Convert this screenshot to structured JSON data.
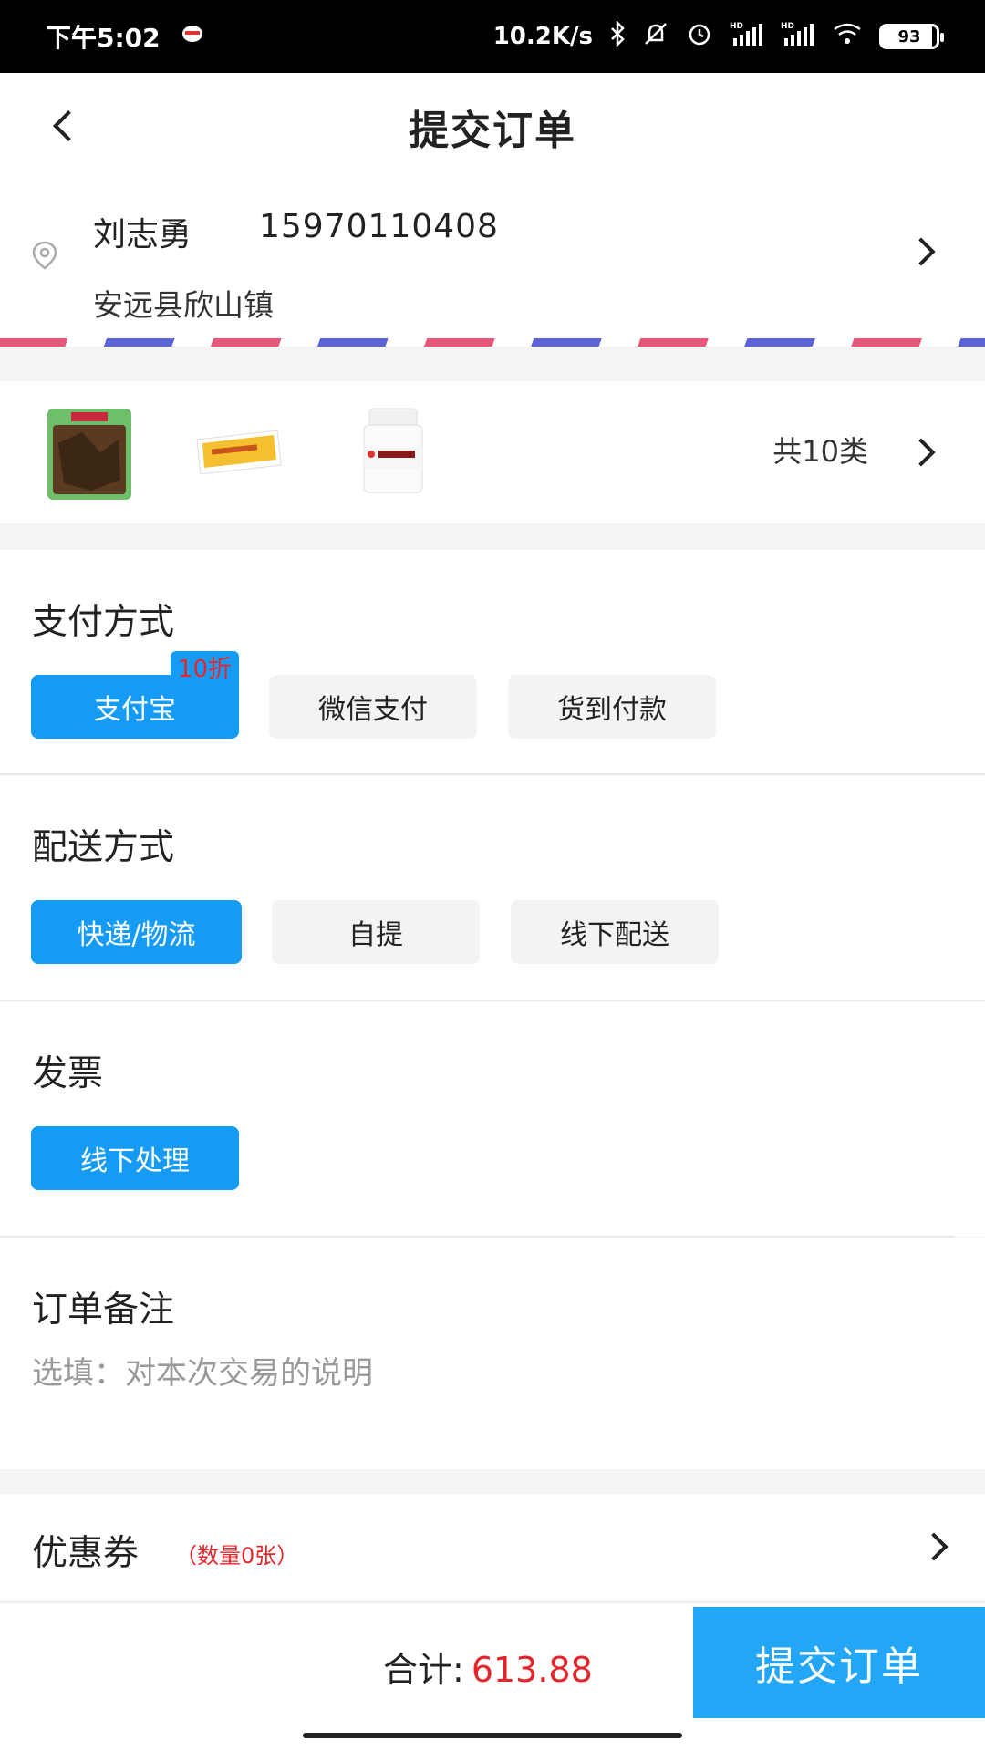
{
  "status_bar": {
    "time": "下午5:02",
    "network_speed": "10.2K/s",
    "signal1": "HD",
    "signal2": "HD",
    "battery": "93",
    "icons": [
      "notification-icon",
      "bluetooth-icon",
      "mute-icon",
      "alarm-icon",
      "signal-icon",
      "signal-icon",
      "wifi-icon",
      "battery-icon"
    ]
  },
  "header": {
    "title": "提交订单",
    "back_icon": "chevron-left-icon"
  },
  "address": {
    "name": "刘志勇",
    "phone": "15970110408",
    "detail": "安远县欣山镇",
    "location_icon": "location-pin-icon",
    "arrow_icon": "chevron-right-icon"
  },
  "products": {
    "count_text": "共10类",
    "arrow_icon": "chevron-right-icon"
  },
  "payment": {
    "title": "支付方式",
    "options": [
      "支付宝",
      "微信支付",
      "货到付款"
    ],
    "selected": "支付宝",
    "discount_tag": "10折"
  },
  "delivery": {
    "title": "配送方式",
    "options": [
      "快递/物流",
      "自提",
      "线下配送"
    ],
    "selected": "快递/物流"
  },
  "invoice": {
    "title": "发票",
    "options": [
      "线下处理"
    ],
    "selected": "线下处理"
  },
  "remark": {
    "title": "订单备注",
    "placeholder": "选填：对本次交易的说明",
    "value": ""
  },
  "coupon": {
    "label": "优惠券",
    "count": "（数量0张）",
    "arrow_icon": "chevron-right-icon"
  },
  "footer": {
    "total_label": "合计:",
    "total_value": "613.88",
    "submit_label": "提交订单"
  },
  "colors": {
    "accent": "#169bf5",
    "price": "#e3262b",
    "submit": "#22a6f5"
  }
}
